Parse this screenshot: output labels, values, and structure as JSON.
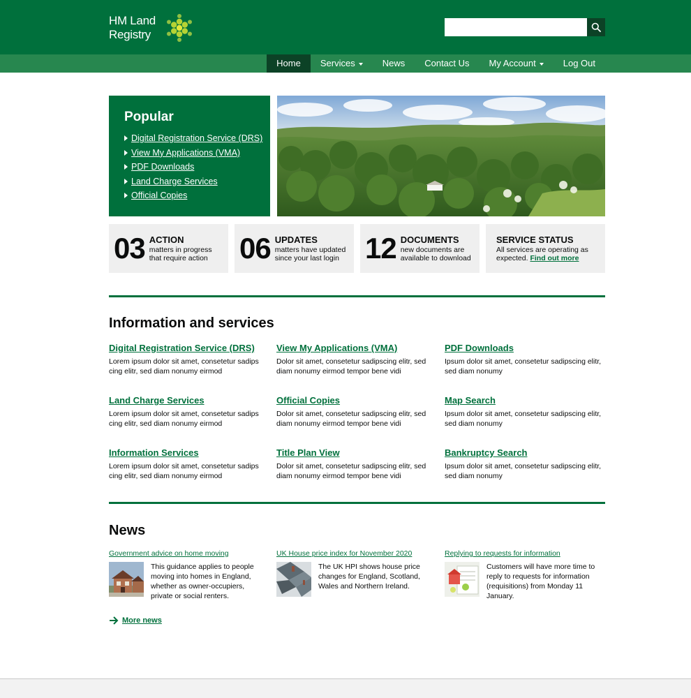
{
  "brand": {
    "line1": "HM Land",
    "line2": "Registry",
    "primary_color": "#00703c",
    "nav_color": "#27874f",
    "dark_color": "#0c4226"
  },
  "search": {
    "placeholder": "",
    "button_icon": "search-icon"
  },
  "nav": {
    "home": "Home",
    "services": "Services",
    "news": "News",
    "contact": "Contact Us",
    "account": "My Account",
    "logout": "Log Out"
  },
  "popular": {
    "title": "Popular",
    "items": [
      "Digital Registration Service (DRS)",
      "View My Applications (VMA)",
      "PDF Downloads",
      "Land Charge Services",
      "Official Copies"
    ]
  },
  "stats": [
    {
      "number": "03",
      "heading": "ACTION",
      "line1": "matters in progress",
      "line2": "that require action"
    },
    {
      "number": "06",
      "heading": "UPDATES",
      "line1": "matters have updated",
      "line2": "since your last login"
    },
    {
      "number": "12",
      "heading": "DOCUMENTS",
      "line1": "new documents are",
      "line2": "available to download"
    }
  ],
  "service_status": {
    "heading": "SERVICE STATUS",
    "line1": "All services are operating as",
    "line2": "expected.",
    "link": "Find out more"
  },
  "info": {
    "heading": "Information and services",
    "items": [
      {
        "title": "Digital Registration Service (DRS)",
        "desc": "Lorem ipsum dolor sit amet, consetetur sadips cing elitr, sed diam nonumy eirmod"
      },
      {
        "title": "View My Applications (VMA)",
        "desc": "Dolor sit amet, consetetur sadipscing elitr, sed diam nonumy eirmod tempor bene vidi"
      },
      {
        "title": "PDF Downloads",
        "desc": "Ipsum dolor sit amet, consetetur sadipscing elitr, sed diam nonumy"
      },
      {
        "title": "Land Charge Services",
        "desc": "Lorem ipsum dolor sit amet, consetetur sadips cing elitr, sed diam nonumy eirmod"
      },
      {
        "title": "Official Copies",
        "desc": "Dolor sit amet, consetetur sadipscing elitr, sed diam nonumy eirmod tempor bene vidi"
      },
      {
        "title": "Map Search",
        "desc": "Ipsum dolor sit amet, consetetur sadipscing elitr, sed diam nonumy"
      },
      {
        "title": "Information Services",
        "desc": "Lorem ipsum dolor sit amet, consetetur sadips cing elitr, sed diam nonumy eirmod"
      },
      {
        "title": "Title Plan View",
        "desc": "Dolor sit amet, consetetur sadipscing elitr, sed diam nonumy eirmod tempor bene vidi"
      },
      {
        "title": "Bankruptcy Search",
        "desc": "Ipsum dolor sit amet, consetetur sadipscing elitr, sed diam nonumy"
      }
    ]
  },
  "news": {
    "heading": "News",
    "items": [
      {
        "title": "Government advice on home moving",
        "text": "This guidance applies to people moving into homes in England, whether as owner-occupiers, private or social renters."
      },
      {
        "title": "UK House price index for November 2020",
        "text": "The UK HPI shows house price changes for England, Scotland, Wales and Northern Ireland."
      },
      {
        "title": "Replying to requests for information",
        "text": "Customers will have more time to reply to requests for information (requisitions) from Monday 11 January."
      }
    ],
    "more": "More news"
  }
}
